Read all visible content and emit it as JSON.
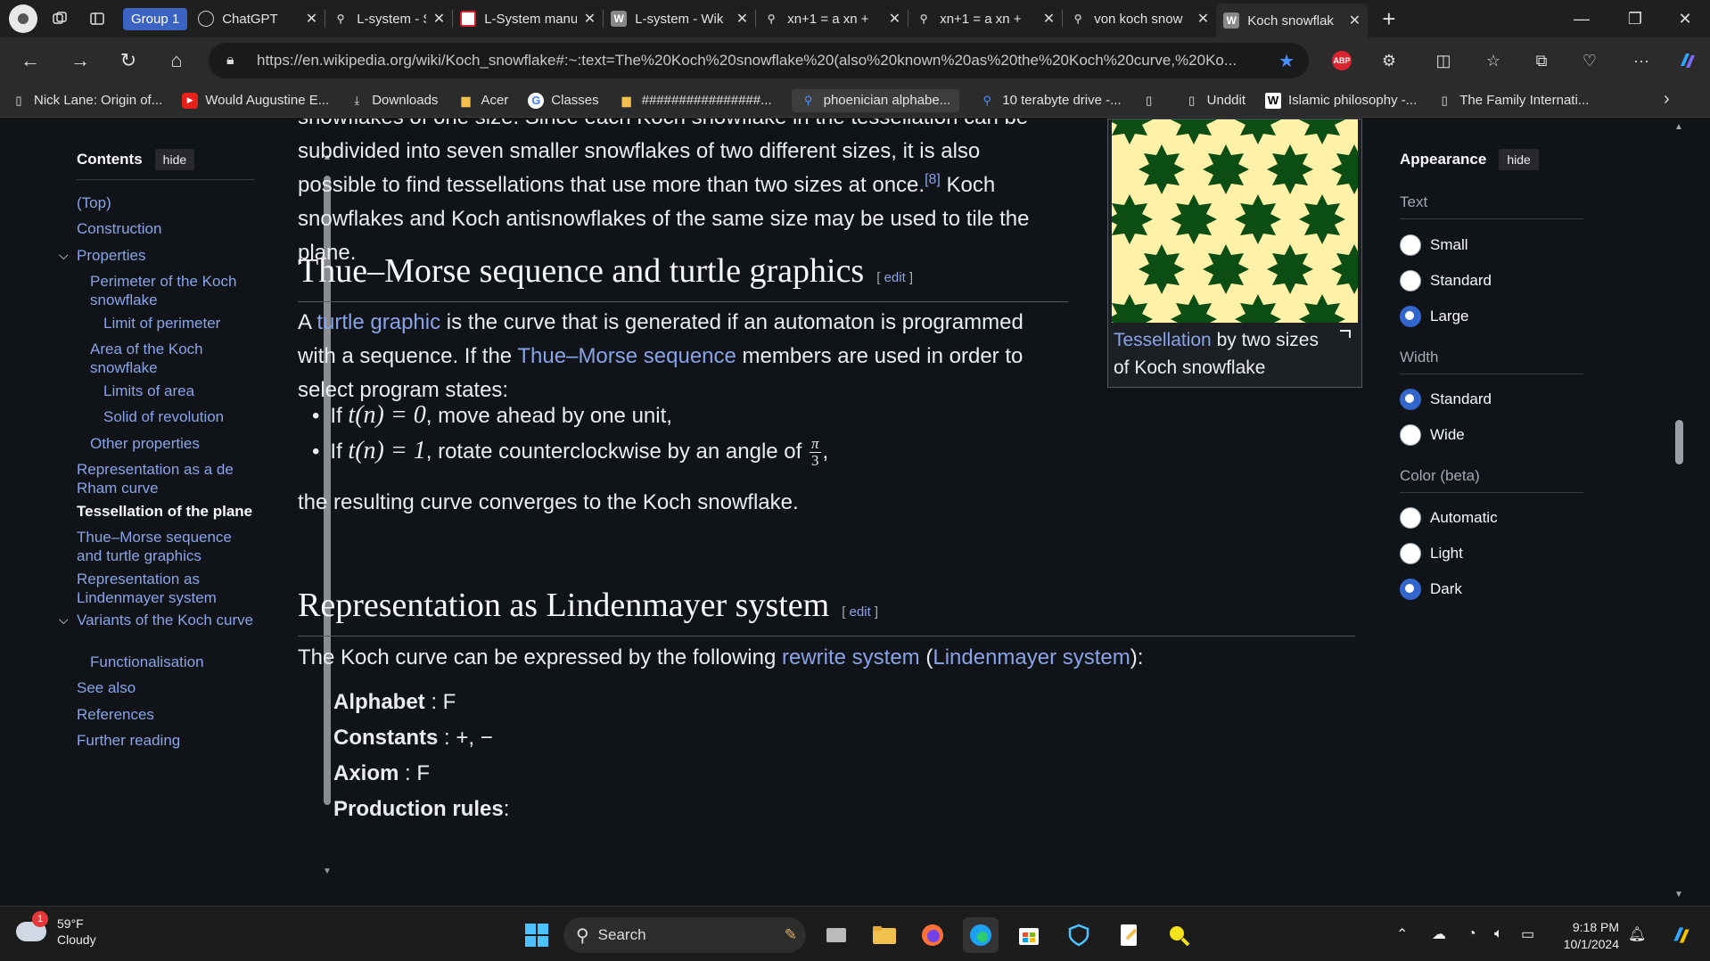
{
  "browser": {
    "tab_group": "Group 1",
    "tabs": [
      {
        "title": "ChatGPT",
        "icon": "chatgpt-icon"
      },
      {
        "title": "L-system - Sea",
        "icon": "search-icon"
      },
      {
        "title": "L-System manu",
        "icon": "lsystem-icon"
      },
      {
        "title": "L-system - Wik",
        "icon": "wikipedia-icon"
      },
      {
        "title": "xn+1 = a xn +",
        "icon": "search-icon"
      },
      {
        "title": "xn+1 = a xn +",
        "icon": "search-icon"
      },
      {
        "title": "von koch snow",
        "icon": "search-icon"
      },
      {
        "title": "Koch snowflak",
        "icon": "wikipedia-icon"
      }
    ],
    "url": "https://en.wikipedia.org/wiki/Koch_snowflake#:~:text=The%20Koch%20snowflake%20(also%20known%20as%20the%20Koch%20curve,%20Ko...",
    "abp_label": "ABP",
    "bookmarks": [
      {
        "label": "Nick Lane: Origin of...",
        "icon": "page-icon"
      },
      {
        "label": "Would Augustine E...",
        "icon": "youtube-icon"
      },
      {
        "label": "Downloads",
        "icon": "download-icon"
      },
      {
        "label": "Acer",
        "icon": "folder-icon"
      },
      {
        "label": "Classes",
        "icon": "google-icon"
      },
      {
        "label": "################...",
        "icon": "folder-icon"
      },
      {
        "label": "phoenician alphabe...",
        "icon": "search-icon"
      },
      {
        "label": "10 terabyte drive -...",
        "icon": "search-icon"
      },
      {
        "label": "",
        "icon": "page-icon"
      },
      {
        "label": "Unddit",
        "icon": "page-icon"
      },
      {
        "label": "Islamic philosophy -...",
        "icon": "wikipedia-icon"
      },
      {
        "label": "The Family Internati...",
        "icon": "page-icon"
      }
    ]
  },
  "toc": {
    "title": "Contents",
    "hide_label": "hide",
    "items": [
      "(Top)",
      "Construction",
      "Properties",
      "Perimeter of the Koch snowflake",
      "Limit of perimeter",
      "Area of the Koch snowflake",
      "Limits of area",
      "Solid of revolution",
      "Other properties",
      "Representation as a de Rham curve",
      "Tessellation of the plane",
      "Thue–Morse sequence and turtle graphics",
      "Representation as Lindenmayer system",
      "Variants of the Koch curve",
      "Functionalisation",
      "See also",
      "References",
      "Further reading"
    ]
  },
  "article": {
    "tess_p1": "snowflakes of one size. Since each Koch snowflake in the tessellation can be",
    "tess_p2": "subdivided into seven smaller snowflakes of two different sizes, it is also",
    "tess_p3": "possible to find tessellations that use more than two sizes at once.",
    "tess_ref": "[8]",
    "tess_p3b": " Koch",
    "tess_p4": "snowflakes and Koch antisnowflakes of the same size may be used to tile the",
    "tess_p5": "plane.",
    "h_thue": "Thue–Morse sequence and turtle graphics",
    "edit": "edit",
    "thue_a": "A ",
    "thue_link1": "turtle graphic",
    "thue_b": " is the curve that is generated if an automaton is programmed",
    "thue_c": "with a sequence. If the ",
    "thue_link2": "Thue–Morse sequence",
    "thue_d": " members are used in order to",
    "thue_e": "select program states:",
    "bullet1_pre": "If ",
    "bullet1_math": "t(n) = 0",
    "bullet1_post": ", move ahead by one unit,",
    "bullet2_pre": "If ",
    "bullet2_math": "t(n) = 1",
    "bullet2_post": ", rotate counterclockwise by an angle of ",
    "frac_num": "π",
    "frac_den": "3",
    "bullet2_end": ",",
    "thue_result": "the resulting curve converges to the Koch snowflake.",
    "h_lsys": "Representation as Lindenmayer system",
    "lsys_a": "The Koch curve can be expressed by the following ",
    "lsys_link1": "rewrite system",
    "lsys_b": " (",
    "lsys_link2": "Lindenmayer system",
    "lsys_c": "):",
    "alphabet_label": "Alphabet",
    "alphabet_value": " : F",
    "constants_label": "Constants",
    "constants_value": " : +, −",
    "axiom_label": "Axiom",
    "axiom_value": " : F",
    "rules_label": "Production rules",
    "rules_value": ":"
  },
  "figure": {
    "caption_link": "Tessellation",
    "caption_rest": " by two sizes of Koch snowflake",
    "colors": {
      "background": "#fff1a8",
      "snowflake": "#0b4d12"
    }
  },
  "appearance": {
    "title": "Appearance",
    "hide_label": "hide",
    "text_label": "Text",
    "text_options": [
      {
        "label": "Small",
        "checked": false
      },
      {
        "label": "Standard",
        "checked": false
      },
      {
        "label": "Large",
        "checked": true
      }
    ],
    "width_label": "Width",
    "width_options": [
      {
        "label": "Standard",
        "checked": true
      },
      {
        "label": "Wide",
        "checked": false
      }
    ],
    "color_label": "Color (beta)",
    "color_options": [
      {
        "label": "Automatic",
        "checked": false
      },
      {
        "label": "Light",
        "checked": false
      },
      {
        "label": "Dark",
        "checked": true
      }
    ]
  },
  "taskbar": {
    "weather_temp": "59°F",
    "weather_desc": "Cloudy",
    "weather_badge": "1",
    "search_label": "Search",
    "time": "9:18 PM",
    "date": "10/1/2024"
  },
  "colors": {
    "accent": "#3366cc",
    "link": "#88a3e8",
    "page_bg": "#101418"
  }
}
